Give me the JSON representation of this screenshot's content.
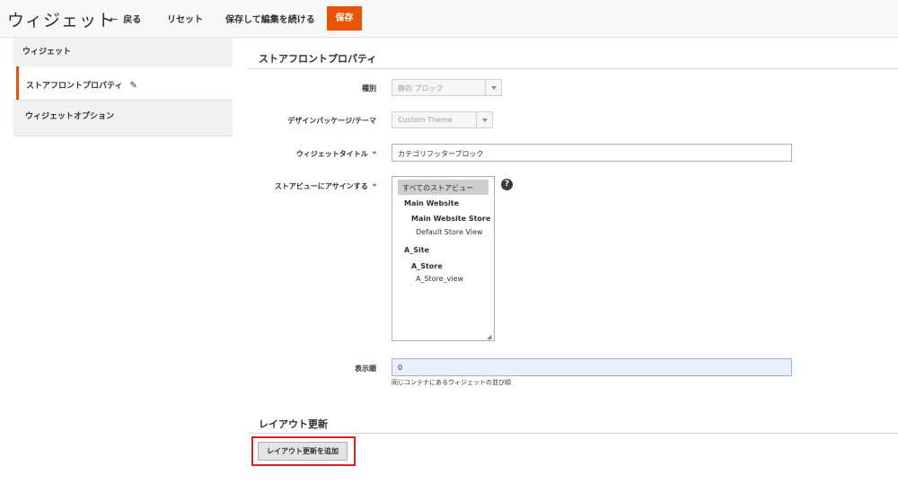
{
  "header": {
    "title": "ウィジェット",
    "back_label": "戻る",
    "reset_label": "リセット",
    "save_continue_label": "保存して編集を続ける",
    "save_label": "保存"
  },
  "sidebar": {
    "title": "ウィジェット",
    "tabs": [
      {
        "label": "ストアフロントプロパティ",
        "active": true
      },
      {
        "label": "ウィジェットオプション",
        "active": false
      }
    ]
  },
  "storefront": {
    "section_title": "ストアフロントプロパティ",
    "type": {
      "label": "種別",
      "value": "静的 ブロック"
    },
    "theme": {
      "label": "デザインパッケージ/テーマ",
      "value": "Custom Theme"
    },
    "widget_title": {
      "label": "ウィジェットタイトル",
      "value": "カテゴリフッターブロック"
    },
    "store_views": {
      "label": "ストアビューにアサインする",
      "selected": "すべてのストアビュー",
      "groups": [
        {
          "website": "Main Website",
          "store": "Main Website Store",
          "view": "Default Store View"
        },
        {
          "website": "A_Site",
          "store": "A_Store",
          "view": "A_Store_view"
        }
      ]
    },
    "sort_order": {
      "label": "表示順",
      "value": "0",
      "note": "同じコンテナにあるウィジェットの並び順"
    }
  },
  "layout": {
    "section_title": "レイアウト更新",
    "add_button_label": "レイアウト更新を追加"
  },
  "icons": {
    "help": "?",
    "pencil": "✎",
    "back_arrow": "←",
    "resize": "◢"
  },
  "colors": {
    "accent": "#eb5202",
    "highlight": "#e02020"
  }
}
